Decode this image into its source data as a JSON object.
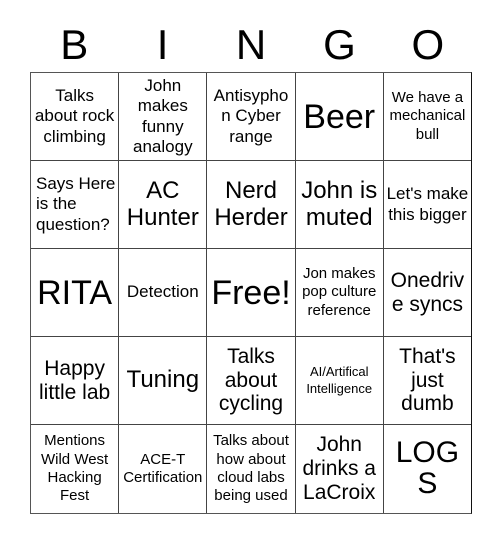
{
  "card": {
    "title": "Bingo Card",
    "header_letters": [
      "B",
      "I",
      "N",
      "G",
      "O"
    ],
    "free_space_label": "Free!",
    "colors": {
      "background": "#ffffff",
      "text": "#000000",
      "grid_line": "#444444"
    },
    "rows": [
      {
        "cells": [
          {
            "text": "Talks about rock climbing",
            "size": "sm",
            "align": "center"
          },
          {
            "text": "John makes funny analogy",
            "size": "sm",
            "align": "center"
          },
          {
            "text": "Antisyphon Cyber range",
            "size": "sm",
            "align": "center"
          },
          {
            "text": "Beer",
            "size": "xxl",
            "align": "center"
          },
          {
            "text": "We have a mechanical bull",
            "size": "xs",
            "align": "center"
          }
        ]
      },
      {
        "cells": [
          {
            "text": "Says Here is the question?",
            "size": "sm",
            "align": "left"
          },
          {
            "text": "AC Hunter",
            "size": "lg",
            "align": "center"
          },
          {
            "text": "Nerd Herder",
            "size": "lg",
            "align": "center"
          },
          {
            "text": "John is muted",
            "size": "lg",
            "align": "center"
          },
          {
            "text": "Let's make this bigger",
            "size": "sm",
            "align": "center"
          }
        ]
      },
      {
        "cells": [
          {
            "text": "RITA",
            "size": "xxl",
            "align": "center"
          },
          {
            "text": "Detection",
            "size": "sm",
            "align": "center"
          },
          {
            "text": "Free!",
            "size": "xxl",
            "align": "center"
          },
          {
            "text": "Jon makes pop culture reference",
            "size": "xs",
            "align": "center"
          },
          {
            "text": "Onedrive syncs",
            "size": "md",
            "align": "center"
          }
        ]
      },
      {
        "cells": [
          {
            "text": "Happy little lab",
            "size": "md",
            "align": "center"
          },
          {
            "text": "Tuning",
            "size": "lg",
            "align": "center"
          },
          {
            "text": "Talks about cycling",
            "size": "md",
            "align": "center"
          },
          {
            "text": "AI/Artifical Intelligence",
            "size": "xxs",
            "align": "center"
          },
          {
            "text": "That's just dumb",
            "size": "md",
            "align": "center"
          }
        ]
      },
      {
        "cells": [
          {
            "text": "Mentions Wild West Hacking Fest",
            "size": "xs",
            "align": "center"
          },
          {
            "text": "ACE-T Certification",
            "size": "xs",
            "align": "center"
          },
          {
            "text": "Talks about how about cloud labs being used",
            "size": "xs",
            "align": "center"
          },
          {
            "text": "John drinks a LaCroix",
            "size": "md",
            "align": "center"
          },
          {
            "text": "LOGS",
            "size": "xl",
            "align": "center"
          }
        ]
      }
    ]
  }
}
